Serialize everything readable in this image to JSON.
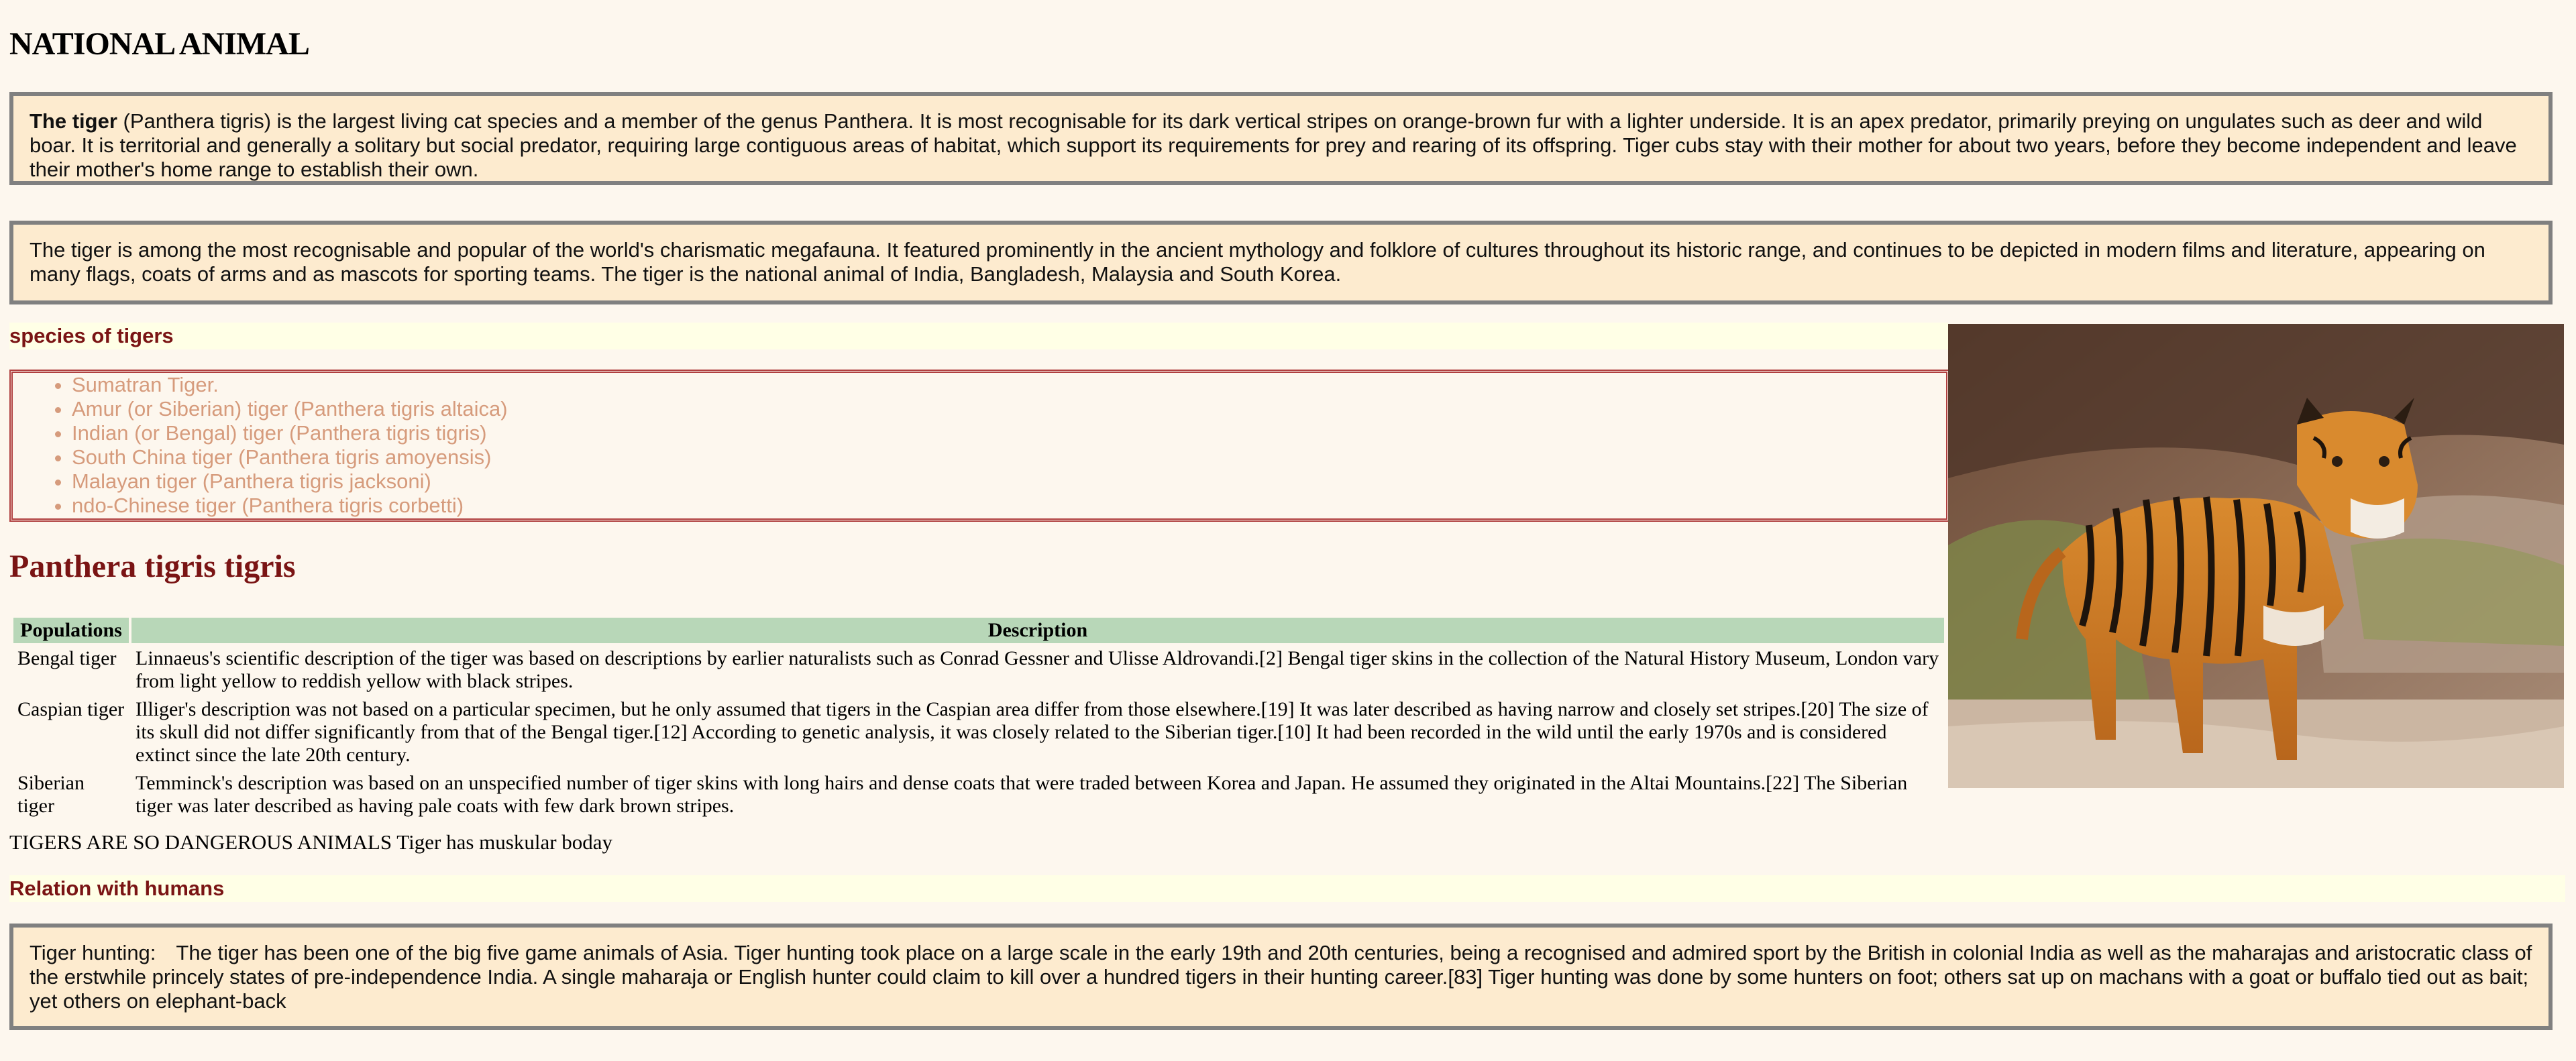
{
  "page": {
    "title": "NATIONAL ANIMAL"
  },
  "intro": {
    "lead": "The tiger",
    "text": " (Panthera tigris) is the largest living cat species and a member of the genus Panthera. It is most recognisable for its dark vertical stripes on orange-brown fur with a lighter underside. It is an apex predator, primarily preying on ungulates such as deer and wild boar. It is territorial and generally a solitary but social predator, requiring large contiguous areas of habitat, which support its requirements for prey and rearing of its offspring. Tiger cubs stay with their mother for about two years, before they become independent and leave their mother's home range to establish their own."
  },
  "charisma": {
    "text": "The tiger is among the most recognisable and popular of the world's charismatic megafauna. It featured prominently in the ancient mythology and folklore of cultures throughout its historic range, and continues to be depicted in modern films and literature, appearing on many flags, coats of arms and as mascots for sporting teams. The tiger is the national animal of India, Bangladesh, Malaysia and South Korea."
  },
  "species": {
    "heading": "species of tigers",
    "items": [
      "Sumatran Tiger.",
      "Amur (or Siberian) tiger (Panthera tigris altaica)",
      "Indian (or Bengal) tiger (Panthera tigris tigris)",
      "South China tiger (Panthera tigris amoyensis)",
      "Malayan tiger (Panthera tigris jacksoni)",
      "ndo-Chinese tiger (Panthera tigris corbetti)"
    ]
  },
  "subspecies": {
    "title": "Panthera tigris tigris"
  },
  "table": {
    "headers": [
      "Populations",
      "Description"
    ],
    "rows": [
      {
        "population": "Bengal tiger",
        "description": "Linnaeus's scientific description of the tiger was based on descriptions by earlier naturalists such as Conrad Gessner and Ulisse Aldrovandi.[2] Bengal tiger skins in the collection of the Natural History Museum, London vary from light yellow to reddish yellow with black stripes."
      },
      {
        "population": "Caspian tiger",
        "description": "Illiger's description was not based on a particular specimen, but he only assumed that tigers in the Caspian area differ from those elsewhere.[19] It was later described as having narrow and closely set stripes.[20] The size of its skull did not differ significantly from that of the Bengal tiger.[12] According to genetic analysis, it was closely related to the Siberian tiger.[10] It had been recorded in the wild until the early 1970s and is considered extinct since the late 20th century."
      },
      {
        "population": "Siberian tiger",
        "description": "Temminck's description was based on an unspecified number of tiger skins with long hairs and dense coats that were traded between Korea and Japan. He assumed they originated in the Altai Mountains.[22] The Siberian tiger was later described as having pale coats with few dark brown stripes."
      }
    ]
  },
  "note": {
    "text": "TIGERS ARE SO DANGEROUS ANIMALS Tiger has muskular boday"
  },
  "relation": {
    "heading": "Relation with humans",
    "label": "Tiger hunting:",
    "text": "The tiger has been one of the big five game animals of Asia. Tiger hunting took place on a large scale in the early 19th and 20th centuries, being a recognised and admired sport by the British in colonial India as well as the maharajas and aristocratic class of the erstwhile princely states of pre-independence India. A single maharaja or English hunter could claim to kill over a hundred tigers in their hunting career.[83] Tiger hunting was done by some hunters on foot; others sat up on machans with a goat or buffalo tied out as bait; yet others on elephant-back"
  },
  "colors": {
    "background": "#fdf7ee",
    "box_fill": "#fdebcf",
    "box_border": "#808080",
    "heading_red": "#7a1414",
    "species_text": "#d69b7c",
    "table_header": "#b8d7b8"
  }
}
